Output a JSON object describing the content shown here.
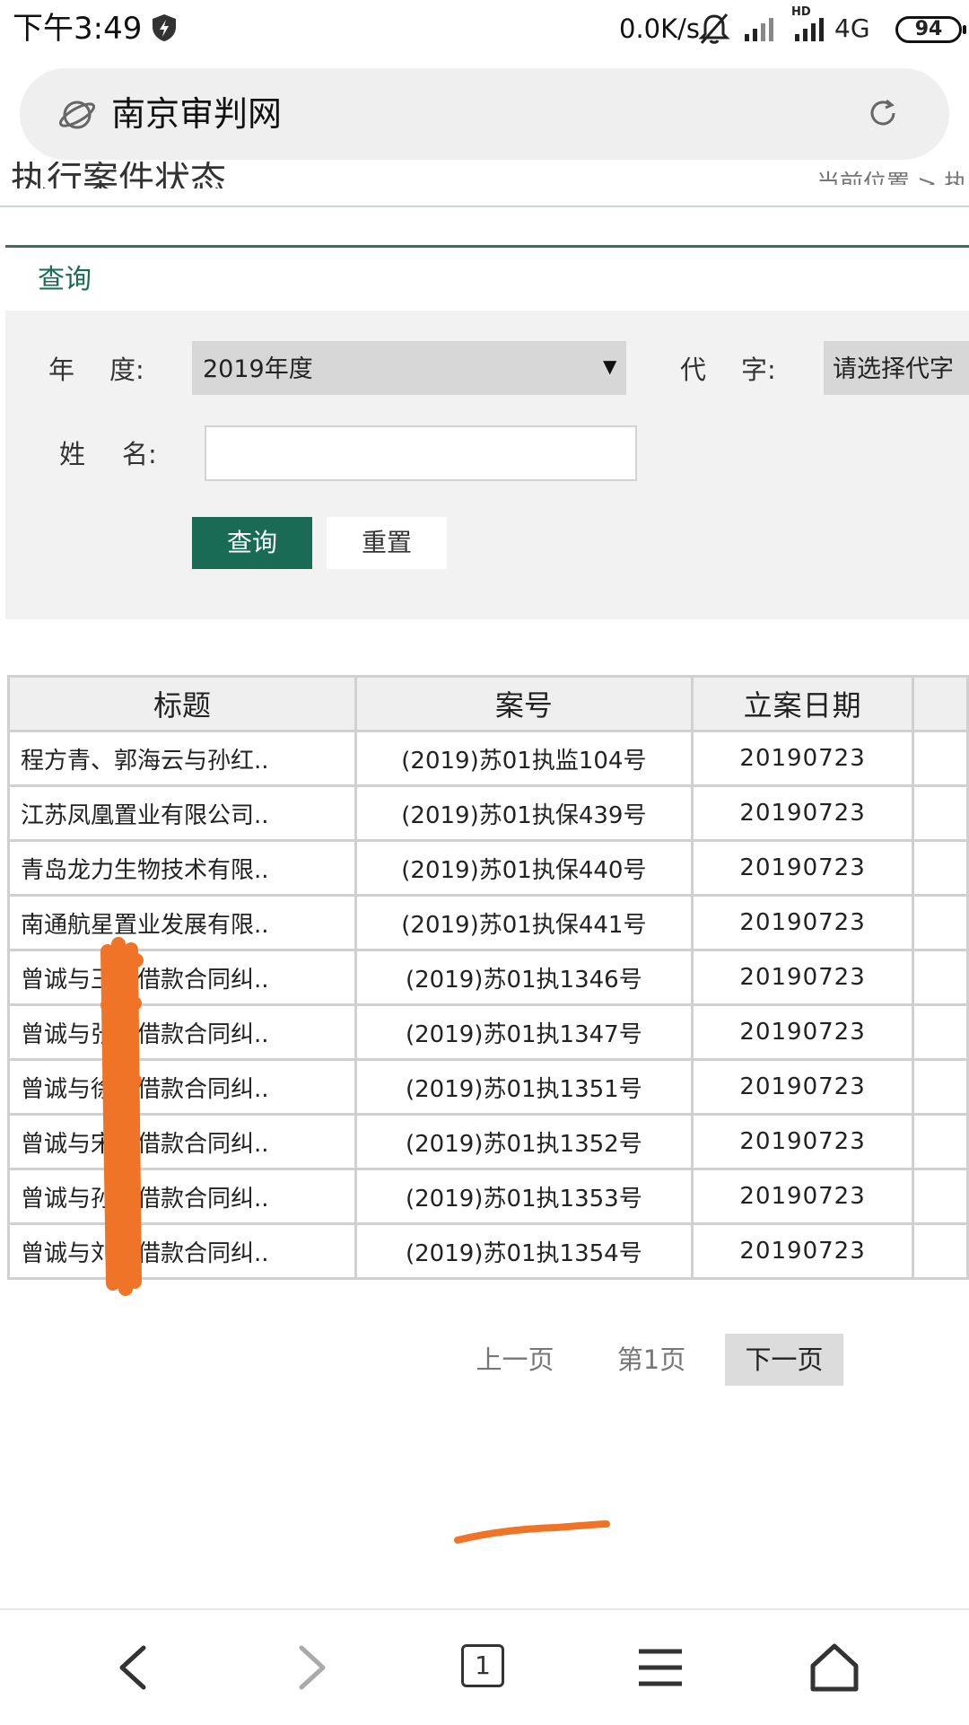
{
  "status_bar": {
    "time": "下午3:49",
    "net_speed": "0.0K/s",
    "hd_label": "HD",
    "network": "4G",
    "battery": "94"
  },
  "address_bar": {
    "title": "南京审判网"
  },
  "header_partial": {
    "title": "执行案件状态",
    "right_text": "当前位置 > 执"
  },
  "query": {
    "tab_label": "查询",
    "year_label_1": "年",
    "year_label_2": "度:",
    "year_value": "2019年度",
    "code_label_1": "代",
    "code_label_2": "字:",
    "code_value": "请选择代字",
    "name_label_1": "姓",
    "name_label_2": "名:",
    "name_value": "",
    "query_button": "查询",
    "reset_button": "重置"
  },
  "table": {
    "headers": [
      "标题",
      "案号",
      "立案日期",
      ""
    ],
    "rows": [
      {
        "title": "程方青、郭海云与孙红..",
        "case_no": "(2019)苏01执监104号",
        "date": "20190723"
      },
      {
        "title": "江苏凤凰置业有限公司..",
        "case_no": "(2019)苏01执保439号",
        "date": "20190723"
      },
      {
        "title": "青岛龙力生物技术有限..",
        "case_no": "(2019)苏01执保440号",
        "date": "20190723"
      },
      {
        "title": "南通航星置业发展有限..",
        "case_no": "(2019)苏01执保441号",
        "date": "20190723"
      },
      {
        "title": "曾诚与王斌借款合同纠..",
        "case_no": "(2019)苏01执1346号",
        "date": "20190723"
      },
      {
        "title": "曾诚与张涵借款合同纠..",
        "case_no": "(2019)苏01执1347号",
        "date": "20190723"
      },
      {
        "title": "曾诚与徐婷借款合同纠..",
        "case_no": "(2019)苏01执1351号",
        "date": "20190723"
      },
      {
        "title": "曾诚与宋婷借款合同纠..",
        "case_no": "(2019)苏01执1352号",
        "date": "20190723"
      },
      {
        "title": "曾诚与孙凤借款合同纠..",
        "case_no": "(2019)苏01执1353号",
        "date": "20190723"
      },
      {
        "title": "曾诚与刘萍借款合同纠..",
        "case_no": "(2019)苏01执1354号",
        "date": "20190723"
      }
    ]
  },
  "pagination": {
    "prev": "上一页",
    "current": "第1页",
    "next": "下一页"
  },
  "bottom_nav": {
    "tab_count": "1"
  },
  "colors": {
    "accent_green": "#1a6b55",
    "annotation_orange": "#f07428"
  }
}
